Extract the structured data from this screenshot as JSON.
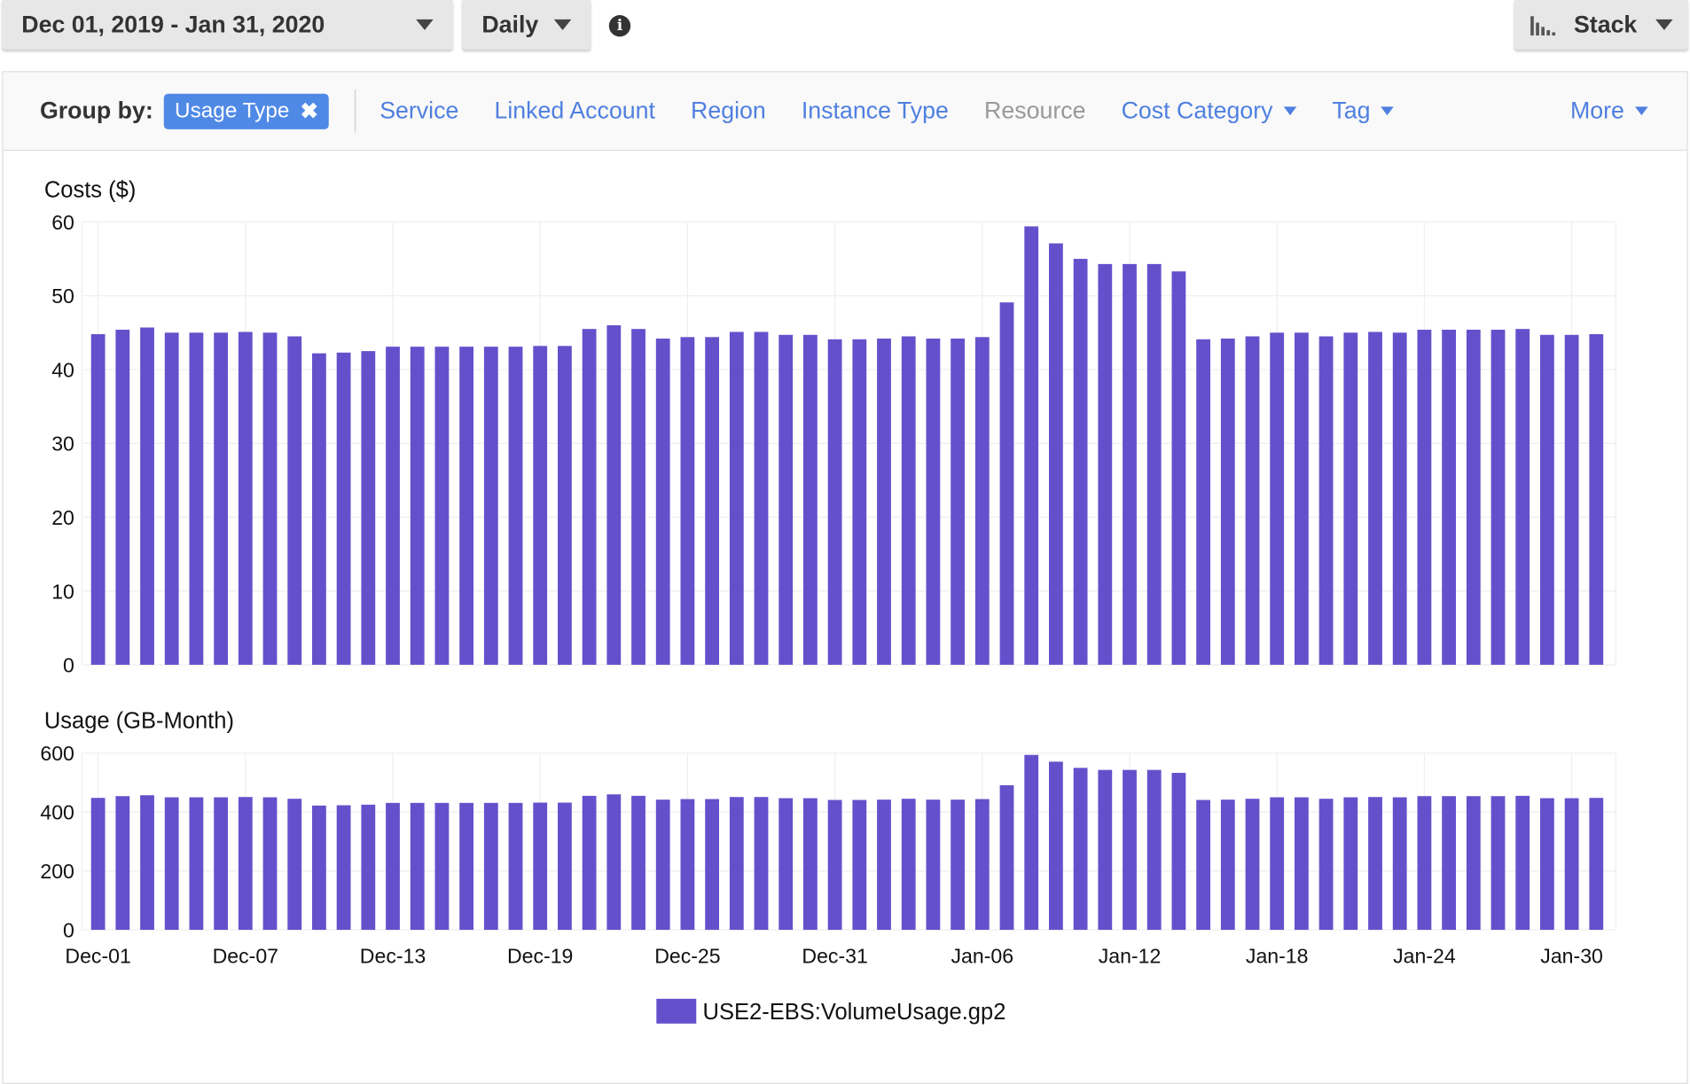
{
  "toolbar": {
    "date_range": "Dec 01, 2019 - Jan 31, 2020",
    "granularity": "Daily",
    "info_icon": "info-circle-icon",
    "chart_style": "Stack",
    "chart_style_icon": "bar-chart-icon"
  },
  "group_by": {
    "label": "Group by:",
    "selected": "Usage Type",
    "items": [
      {
        "label": "Service",
        "enabled": true,
        "dropdown": false
      },
      {
        "label": "Linked Account",
        "enabled": true,
        "dropdown": false
      },
      {
        "label": "Region",
        "enabled": true,
        "dropdown": false
      },
      {
        "label": "Instance Type",
        "enabled": true,
        "dropdown": false
      },
      {
        "label": "Resource",
        "enabled": false,
        "dropdown": false
      },
      {
        "label": "Cost Category",
        "enabled": true,
        "dropdown": true
      },
      {
        "label": "Tag",
        "enabled": true,
        "dropdown": true
      }
    ],
    "more": "More"
  },
  "colors": {
    "series": "#6550cc",
    "link": "#4f7fe0",
    "chip": "#4f89e6"
  },
  "chart_data": [
    {
      "type": "bar",
      "title": "Costs ($)",
      "ylim": [
        0,
        60
      ],
      "yticks": [
        0,
        10,
        20,
        30,
        40,
        50,
        60
      ],
      "grid": true,
      "series": [
        {
          "name": "USE2-EBS:VolumeUsage.gp2",
          "values": [
            44.8,
            45.4,
            45.7,
            45.0,
            45.0,
            45.0,
            45.1,
            45.0,
            44.5,
            42.2,
            42.3,
            42.5,
            43.1,
            43.1,
            43.1,
            43.1,
            43.1,
            43.1,
            43.2,
            43.2,
            45.5,
            46.0,
            45.5,
            44.2,
            44.4,
            44.4,
            45.1,
            45.1,
            44.7,
            44.7,
            44.1,
            44.1,
            44.2,
            44.5,
            44.2,
            44.2,
            44.4,
            49.1,
            59.4,
            57.1,
            55.0,
            54.3,
            54.3,
            54.3,
            53.3,
            44.1,
            44.2,
            44.5,
            45.0,
            45.0,
            44.5,
            45.0,
            45.1,
            45.0,
            45.4,
            45.4,
            45.4,
            45.4,
            45.5,
            44.7,
            44.7,
            44.8
          ]
        }
      ]
    },
    {
      "type": "bar",
      "title": "Usage (GB-Month)",
      "ylim": [
        0,
        600
      ],
      "yticks": [
        0,
        200,
        400,
        600
      ],
      "grid": true,
      "series": [
        {
          "name": "USE2-EBS:VolumeUsage.gp2",
          "values": [
            448,
            454,
            457,
            450,
            450,
            450,
            451,
            450,
            445,
            422,
            423,
            425,
            431,
            431,
            431,
            431,
            431,
            431,
            432,
            432,
            455,
            460,
            455,
            442,
            444,
            444,
            451,
            451,
            447,
            447,
            441,
            441,
            442,
            445,
            442,
            442,
            444,
            491,
            594,
            571,
            550,
            543,
            543,
            543,
            533,
            441,
            442,
            445,
            450,
            450,
            445,
            450,
            451,
            450,
            454,
            454,
            454,
            454,
            455,
            447,
            447,
            448
          ]
        }
      ]
    }
  ],
  "x_axis": {
    "count": 62,
    "tick_labels": [
      "Dec-01",
      "Dec-07",
      "Dec-13",
      "Dec-19",
      "Dec-25",
      "Dec-31",
      "Jan-06",
      "Jan-12",
      "Jan-18",
      "Jan-24",
      "Jan-30"
    ],
    "tick_every": 6
  },
  "legend": {
    "label": "USE2-EBS:VolumeUsage.gp2",
    "placement": "bottom-center"
  }
}
